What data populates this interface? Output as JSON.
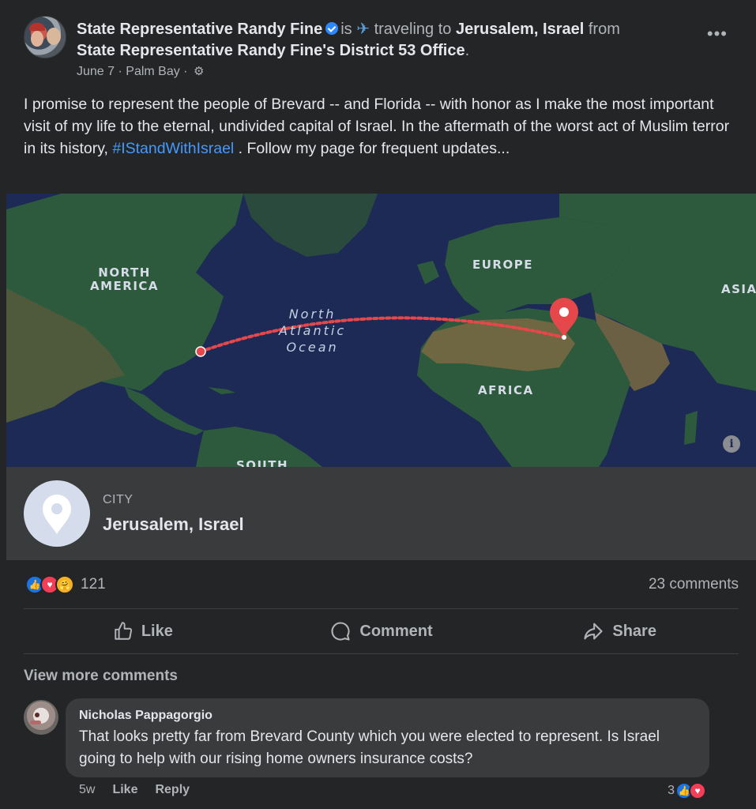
{
  "post": {
    "author": "State Representative Randy Fine",
    "is_text": "is",
    "activity": "traveling to",
    "destination": "Jerusalem, Israel",
    "from_text": "from",
    "origin": "State Representative Randy Fine's District 53 Office",
    "origin_end": ".",
    "date": "June 7",
    "location": "Palm Bay",
    "more_label": "•••",
    "text_part1": "I promise to represent the people of Brevard -- and  Florida -- with honor as I make the most important visit of my life to the eternal, undivided capital of Israel.  In the aftermath of the worst act of Muslim terror in its history, ",
    "hashtag": "#IStandWithIsrael",
    "text_part2": " .  Follow my page for frequent updates..."
  },
  "map": {
    "labels": {
      "north_america": "NORTH\nAMERICA",
      "europe": "EUROPE",
      "asia": "ASIA",
      "africa": "AFRICA",
      "south": "SOUTH",
      "ocean": "North\nAtlantic\nOcean"
    },
    "info": "i"
  },
  "place": {
    "type": "CITY",
    "name": "Jerusalem, Israel"
  },
  "stats": {
    "reactions_count": "121",
    "comments_count": "23 comments"
  },
  "actions": {
    "like": "Like",
    "comment": "Comment",
    "share": "Share"
  },
  "comments": {
    "view_more": "View more comments",
    "items": [
      {
        "author": "Nicholas Pappagorgio",
        "text": "That looks pretty far from Brevard County which you were elected to represent. Is Israel going to help with our rising home owners insurance costs?",
        "time": "5w",
        "like_label": "Like",
        "reply_label": "Reply",
        "reaction_count": "3"
      }
    ]
  },
  "colors": {
    "background": "#242526",
    "card": "#3a3b3c",
    "accent": "#4599ff",
    "pin": "#e5474b",
    "route": "#e5474b"
  }
}
